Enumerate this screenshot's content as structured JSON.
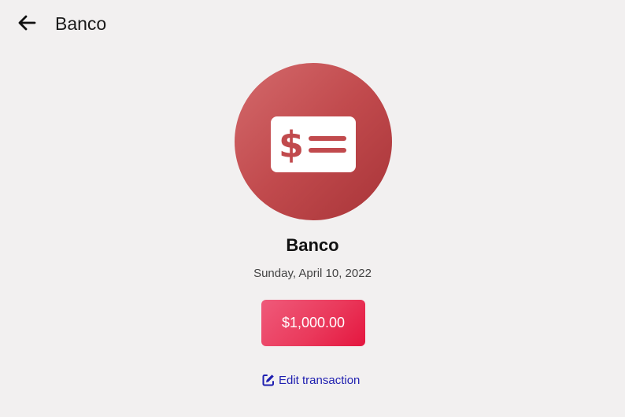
{
  "header": {
    "title": "Banco",
    "back_icon": "arrow-left-icon"
  },
  "transaction": {
    "icon": "money-check-dollar-icon",
    "icon_bg_color": "#c14a4d",
    "name": "Banco",
    "date": "Sunday, April 10, 2022",
    "amount": "$1,000.00",
    "amount_color": "#ea3a5c"
  },
  "actions": {
    "edit_icon": "edit-icon",
    "edit_label": "Edit transaction",
    "link_color": "#1f1fb0"
  }
}
